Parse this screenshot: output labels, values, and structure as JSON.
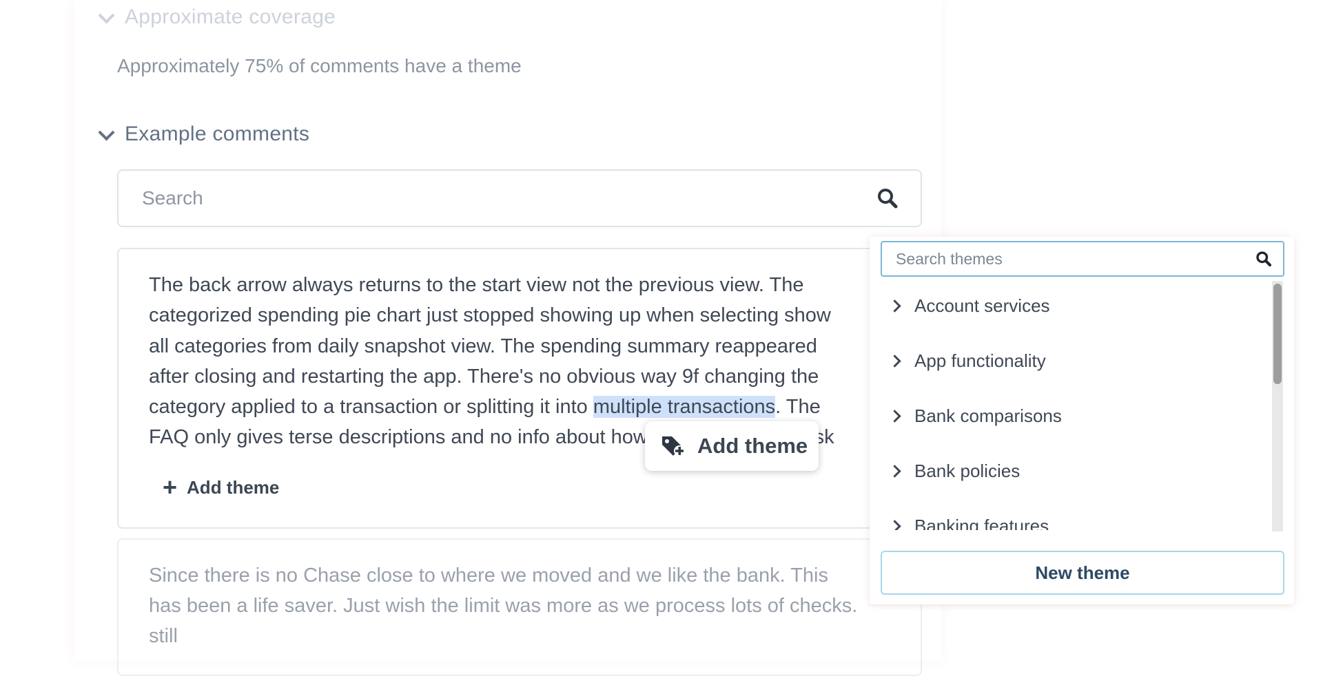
{
  "coverage": {
    "heading": "Approximate coverage",
    "text": "Approximately 75% of comments have a theme"
  },
  "examples": {
    "heading": "Example comments",
    "search_placeholder": "Search"
  },
  "comment1": {
    "before": "The back arrow always returns to the start view not the previous view. The\ncategorized spending pie chart just stopped showing up when selecting show\nall categories from daily snapshot view. The spending summary reappeared\nafter closing and restarting the app. There's no obvious way 9f changing the\ncategory applied to a transaction or splitting it into ",
    "highlight": "multiple transactions",
    "after": ". The\nFAQ only gives terse descriptions and no info about how to accomplish a task",
    "add_theme_label": "Add theme"
  },
  "comment2": {
    "text": "Since there is no Chase close to where we moved and we like the bank. This has been a life saver. Just wish the limit was more as we process lots of checks. still"
  },
  "popover": {
    "label": "Add theme",
    "icon": "tag-plus-icon"
  },
  "theme_picker": {
    "search_placeholder": "Search themes",
    "items": [
      "Account services",
      "App functionality",
      "Bank comparisons",
      "Bank policies",
      "Banking features"
    ],
    "new_theme_label": "New theme"
  },
  "colors": {
    "highlight": "#cfe1fa",
    "focus_border": "#7ab6d8",
    "button_border": "#a7d7e8",
    "text": "#3f4855",
    "muted": "#8d95a2"
  }
}
